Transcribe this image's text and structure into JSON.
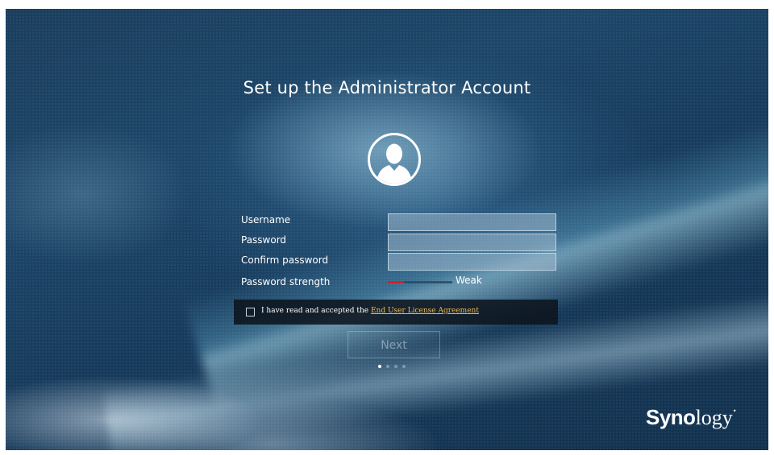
{
  "setup": {
    "title": "Set up the Administrator Account"
  },
  "form": {
    "username_label": "Username",
    "password_label": "Password",
    "confirm_label": "Confirm password",
    "strength_label": "Password strength",
    "username_value": "",
    "password_value": "",
    "confirm_value": "",
    "strength_word": "Weak",
    "strength_level": 0.25
  },
  "eula": {
    "text": "I have read and accepted the ",
    "link": "End User License Agreement",
    "checked": false
  },
  "actions": {
    "next_label": "Next"
  },
  "pager": {
    "count": 4,
    "current": 1
  },
  "brand": {
    "logo_part1": "Syno",
    "logo_part2": "logy",
    "trademark": "•"
  },
  "colors": {
    "accent_link": "#f2b84a",
    "strength_weak": "#d0222a"
  },
  "icons": {
    "avatar": "user-silhouette-icon",
    "checkbox": "checkbox-icon"
  }
}
